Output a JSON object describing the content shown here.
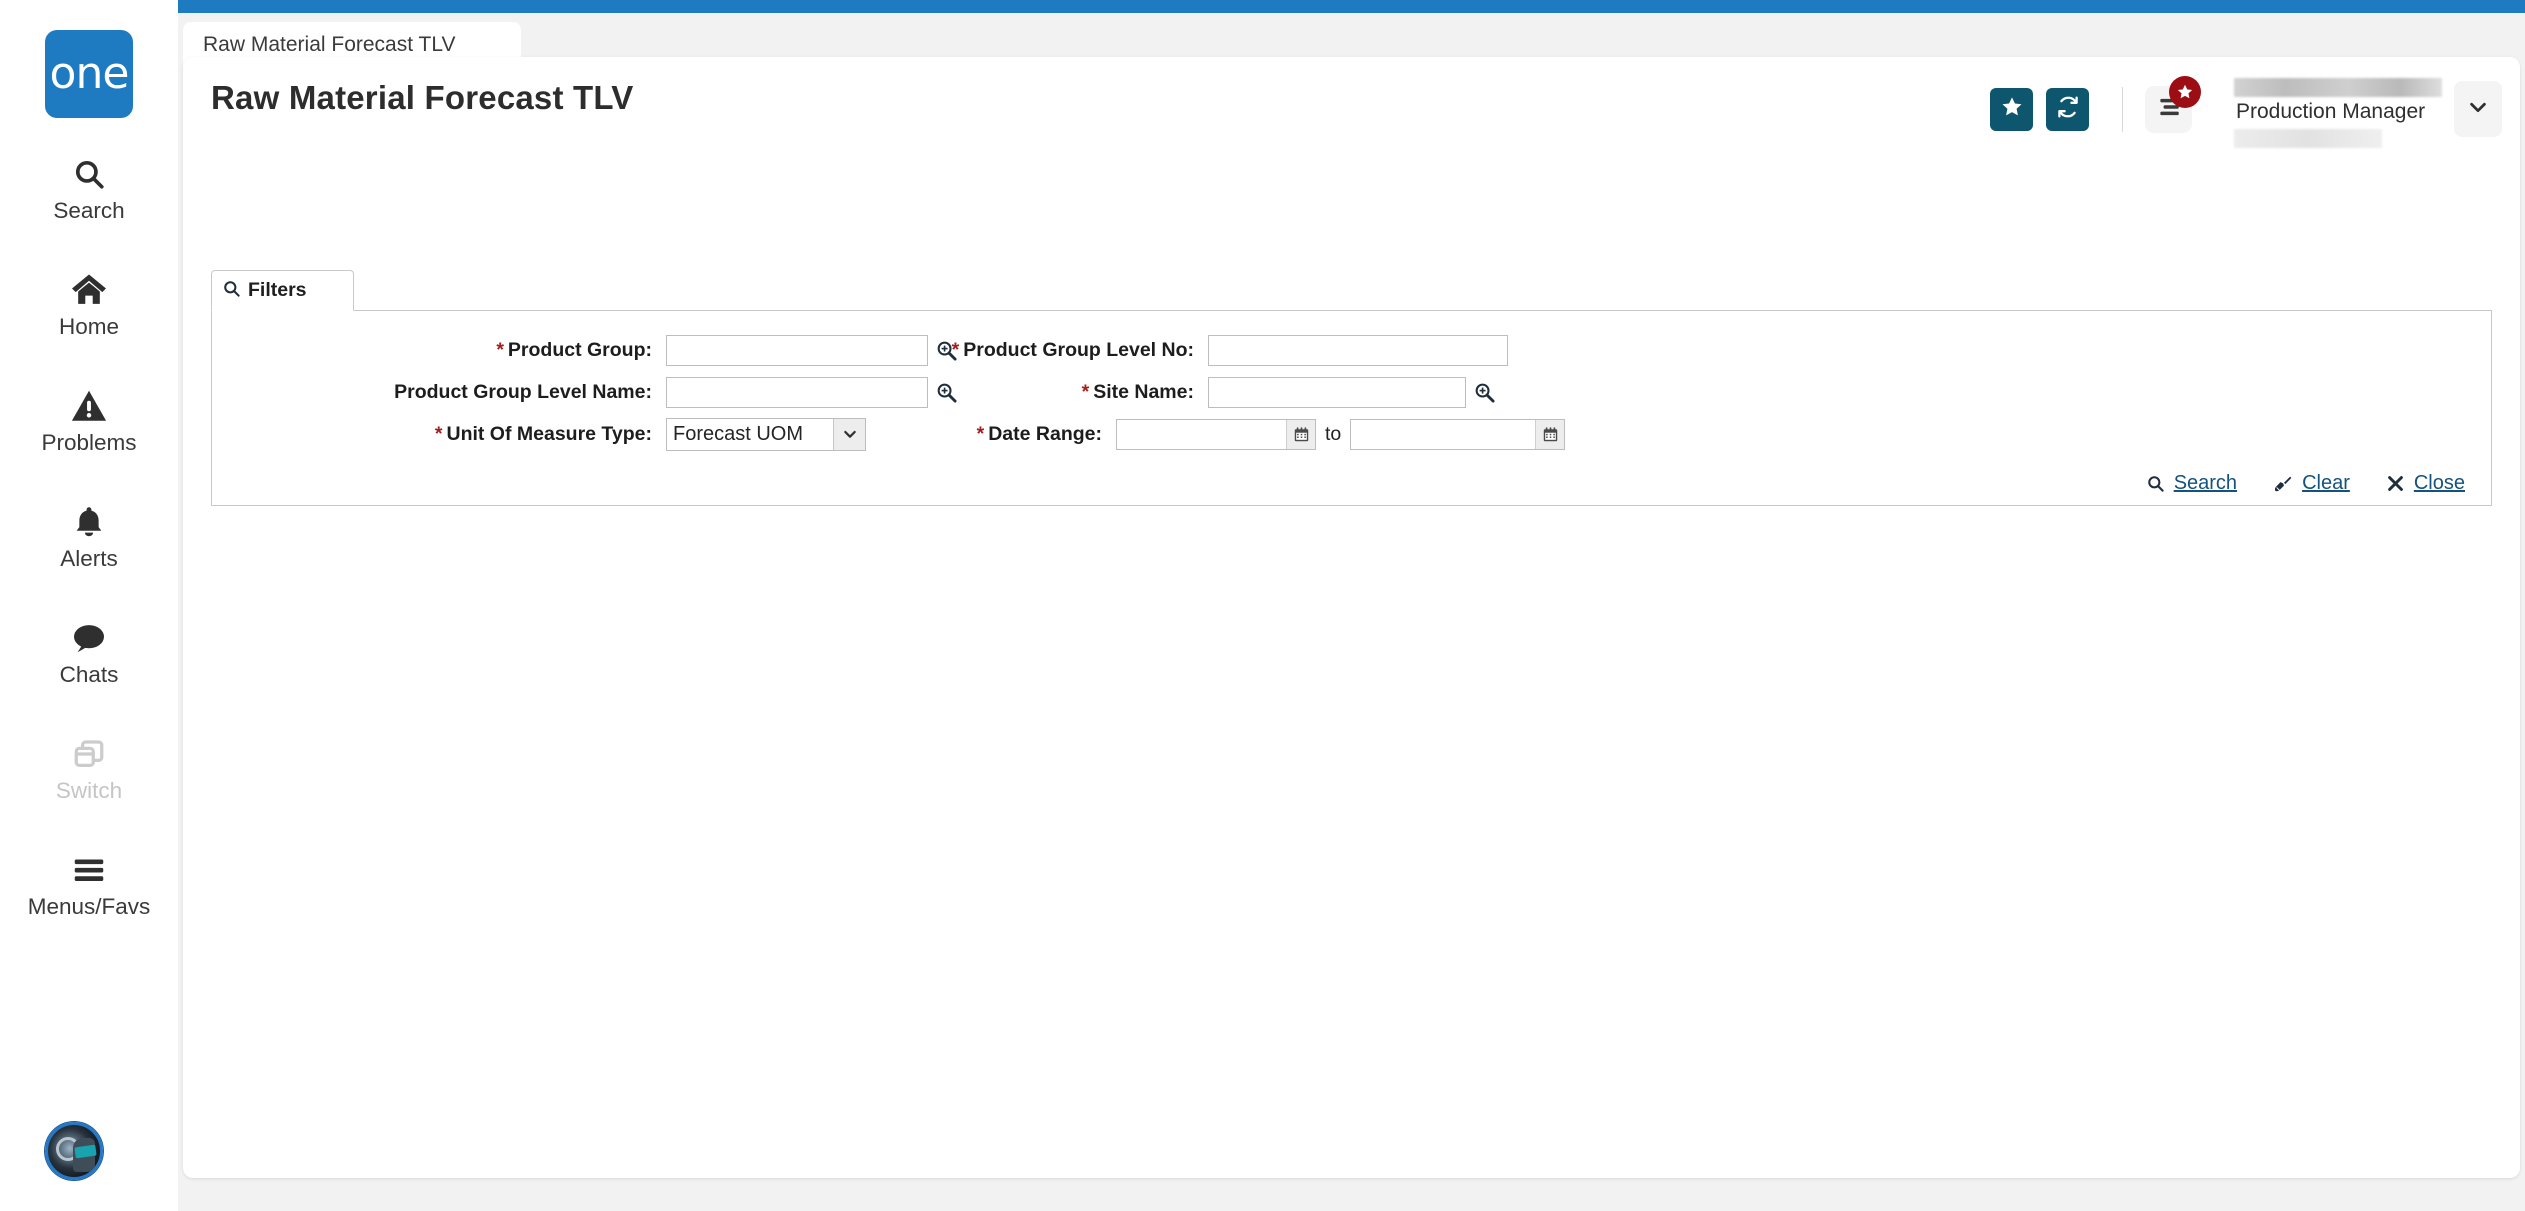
{
  "sidebar": {
    "logo_text": "one",
    "items": [
      {
        "label": "Search",
        "icon": "search-icon",
        "disabled": false
      },
      {
        "label": "Home",
        "icon": "home-icon",
        "disabled": false
      },
      {
        "label": "Problems",
        "icon": "warning-icon",
        "disabled": false
      },
      {
        "label": "Alerts",
        "icon": "bell-icon",
        "disabled": false
      },
      {
        "label": "Chats",
        "icon": "chat-icon",
        "disabled": false
      },
      {
        "label": "Switch",
        "icon": "switch-icon",
        "disabled": true
      },
      {
        "label": "Menus/Favs",
        "icon": "hamburger-icon",
        "disabled": false
      }
    ],
    "avatar": "user-avatar"
  },
  "tabbar": {
    "active_tab": "Raw Material Forecast TLV"
  },
  "header": {
    "title": "Raw Material Forecast TLV",
    "favorite_icon": "star-icon",
    "refresh_icon": "refresh-icon",
    "menu_icon": "list-icon",
    "badge_icon": "star-icon",
    "user_role": "Production Manager",
    "caret_icon": "chevron-down-icon"
  },
  "filters": {
    "tab_label": "Filters",
    "tab_icon": "search-icon",
    "fields": {
      "product_group": {
        "label": "Product Group:",
        "required": true,
        "value": "",
        "placeholder": "",
        "lookup_icon": "magnifier-plus-icon"
      },
      "product_group_level_no": {
        "label": "Product Group Level No:",
        "required": true,
        "value": "",
        "placeholder": ""
      },
      "product_group_level_name": {
        "label": "Product Group Level Name:",
        "required": false,
        "value": "",
        "placeholder": "",
        "lookup_icon": "magnifier-plus-icon"
      },
      "site_name": {
        "label": "Site Name:",
        "required": true,
        "value": "",
        "placeholder": "",
        "lookup_icon": "magnifier-plus-icon"
      },
      "unit_of_measure_type": {
        "label": "Unit Of Measure Type:",
        "required": true,
        "value": "Forecast UOM",
        "options": [
          "Forecast UOM"
        ],
        "arrow_icon": "chevron-down-icon"
      },
      "date_range": {
        "label": "Date Range:",
        "required": true,
        "from_value": "",
        "to_value": "",
        "separator": "to",
        "calendar_icon": "calendar-icon"
      }
    },
    "actions": [
      {
        "label": "Search",
        "icon": "search-icon"
      },
      {
        "label": "Clear",
        "icon": "broom-icon"
      },
      {
        "label": "Close",
        "icon": "close-icon"
      }
    ]
  },
  "colors": {
    "brand_blue": "#1e7bc1",
    "teal": "#0d566e",
    "badge_red": "#9c0d14",
    "link_blue": "#15527d",
    "required_red": "#a51c1c",
    "tab_underline": "#105c6b"
  }
}
